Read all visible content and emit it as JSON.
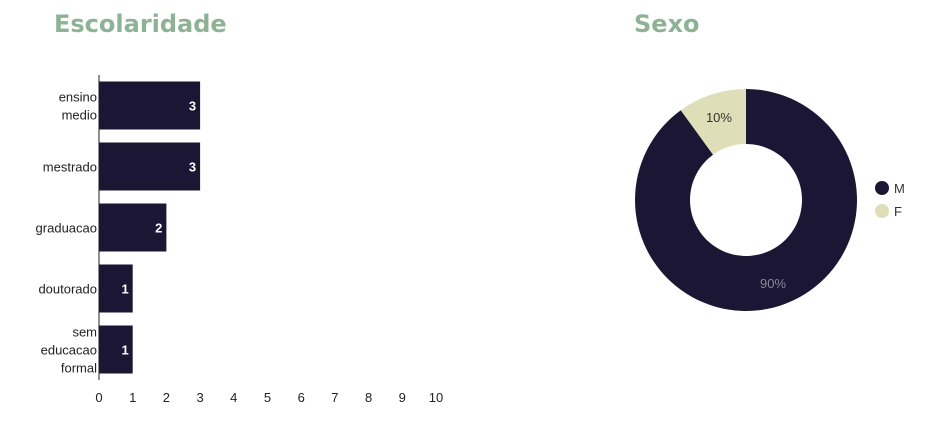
{
  "chart_data": [
    {
      "type": "bar",
      "orientation": "horizontal",
      "title": "Escolaridade",
      "categories": [
        [
          "ensino",
          "medio"
        ],
        [
          "mestrado"
        ],
        [
          "graduacao"
        ],
        [
          "doutorado"
        ],
        [
          "sem",
          "educacao",
          "formal"
        ]
      ],
      "values": [
        3,
        3,
        2,
        1,
        1
      ],
      "xlim": [
        0,
        10
      ],
      "xticks": [
        0,
        1,
        2,
        3,
        4,
        5,
        6,
        7,
        8,
        9,
        10
      ],
      "grid": false,
      "data_labels": true,
      "bar_color": "#1a1633",
      "label_color": "#ffffff"
    },
    {
      "type": "pie",
      "donut": true,
      "title": "Sexo",
      "labels": [
        "M",
        "F"
      ],
      "values": [
        90,
        10
      ],
      "value_labels": [
        "90%",
        "10%"
      ],
      "colors": [
        "#1a1633",
        "#dedfb8"
      ],
      "label_colors": [
        "#8b8a99",
        "#333333"
      ],
      "legend_position": "right"
    }
  ],
  "title_color": "#8db394"
}
